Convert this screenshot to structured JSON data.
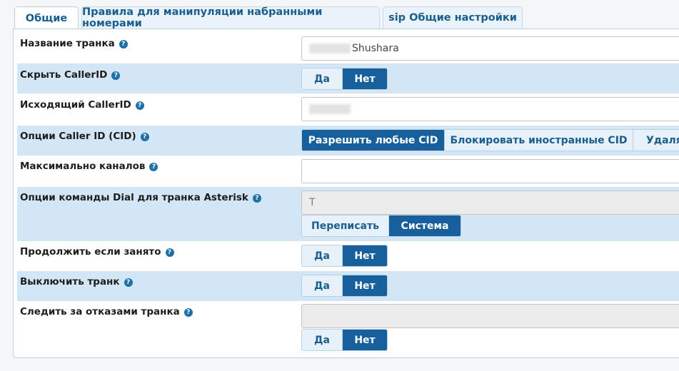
{
  "tabs": [
    {
      "label": "Общие",
      "active": true
    },
    {
      "label": "Правила для манипуляции набранными номерами",
      "active": false
    },
    {
      "label": "sip Общие настройки",
      "active": false
    }
  ],
  "help_glyph": "?",
  "fields": {
    "trunk_name": {
      "label": "Название транка",
      "value": "Shushara"
    },
    "hide_callerid": {
      "label": "Скрыть CallerID",
      "yes": "Да",
      "no": "Нет",
      "selected": "Нет"
    },
    "outbound_callerid": {
      "label": "Исходящий CallerID",
      "value": ""
    },
    "cid_options": {
      "label": "Опции Caller ID (CID)",
      "options": [
        "Разрешить любые CID",
        "Блокировать иностранные CID",
        "Удалят"
      ],
      "selected": "Разрешить любые CID"
    },
    "max_channels": {
      "label": "Максимально каналов",
      "value": ""
    },
    "dial_options": {
      "label": "Опции команды Dial для транка Asterisk",
      "value": "T",
      "override": "Переписать",
      "system": "Система",
      "selected": "Система"
    },
    "continue_if_busy": {
      "label": "Продолжить если занято",
      "yes": "Да",
      "no": "Нет",
      "selected": "Нет"
    },
    "disable_trunk": {
      "label": "Выключить транк",
      "yes": "Да",
      "no": "Нет",
      "selected": "Нет"
    },
    "monitor_failures": {
      "label": "Следить за отказами транка",
      "value": "",
      "yes": "Да",
      "no": "Нет",
      "selected": "Нет"
    }
  },
  "colors": {
    "accent": "#17609b",
    "row_shade": "#d3e6f5",
    "tab_text": "#1a5d8f"
  }
}
